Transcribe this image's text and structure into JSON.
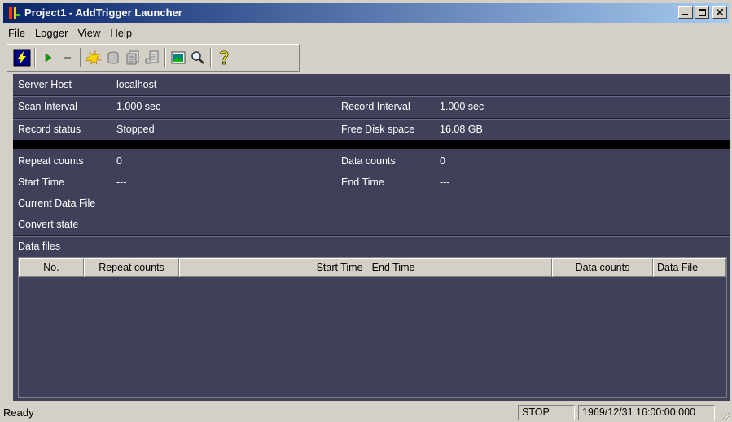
{
  "window": {
    "title": "Project1 - AddTrigger Launcher"
  },
  "menu": {
    "items": [
      "File",
      "Logger",
      "View",
      "Help"
    ]
  },
  "toolbar": {
    "icons": [
      "lightning-icon",
      "play-icon",
      "stop-icon",
      "sparkle-icon",
      "database-icon",
      "document-stack-icon",
      "document-export-icon",
      "picture-icon",
      "magnifier-icon",
      "help-icon"
    ]
  },
  "info": {
    "server_host_label": "Server Host",
    "server_host_value": "localhost",
    "scan_interval_label": "Scan Interval",
    "scan_interval_value": "1.000 sec",
    "record_interval_label": "Record Interval",
    "record_interval_value": "1.000 sec",
    "record_status_label": "Record status",
    "record_status_value": "Stopped",
    "free_disk_label": "Free Disk space",
    "free_disk_value": "16.08 GB",
    "repeat_counts_label": "Repeat counts",
    "repeat_counts_value": "0",
    "data_counts_label": "Data counts",
    "data_counts_value": "0",
    "start_time_label": "Start Time",
    "start_time_value": "---",
    "end_time_label": "End Time",
    "end_time_value": "---",
    "current_data_file_label": "Current Data File",
    "convert_state_label": "Convert state"
  },
  "data_files": {
    "title": "Data files",
    "columns": [
      "No.",
      "Repeat counts",
      "Start Time - End Time",
      "Data counts",
      "Data File"
    ]
  },
  "status": {
    "ready": "Ready",
    "mode": "STOP",
    "datetime": "1969/12/31 16:00:00.000"
  }
}
